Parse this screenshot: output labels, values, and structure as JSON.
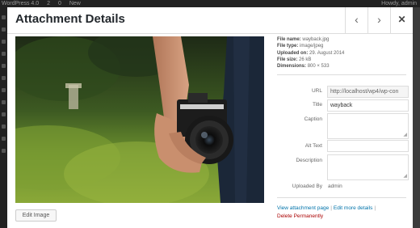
{
  "adminbar": {
    "site": "WordPress 4.0",
    "updates": "2",
    "comments": "0",
    "new": "New",
    "howdy": "Howdy, admin"
  },
  "modal": {
    "title": "Attachment Details",
    "prev_label": "‹",
    "next_label": "›",
    "close_label": "✕"
  },
  "image": {
    "edit_label": "Edit Image"
  },
  "details": [
    {
      "label": "File name:",
      "value": "wayback.jpg"
    },
    {
      "label": "File type:",
      "value": "image/jpeg"
    },
    {
      "label": "Uploaded on:",
      "value": "29. August 2014"
    },
    {
      "label": "File size:",
      "value": "26 kB"
    },
    {
      "label": "Dimensions:",
      "value": "800 × 533"
    }
  ],
  "fields": {
    "url_label": "URL",
    "url_value": "http://localhost/wp4/wp-con",
    "title_label": "Title",
    "title_value": "wayback",
    "caption_label": "Caption",
    "alt_label": "Alt Text",
    "description_label": "Description",
    "uploaded_by_label": "Uploaded By",
    "uploaded_by_value": "admin"
  },
  "actions": {
    "view": "View attachment page",
    "edit": "Edit more details",
    "delete": "Delete Permanently",
    "sep": "|"
  }
}
